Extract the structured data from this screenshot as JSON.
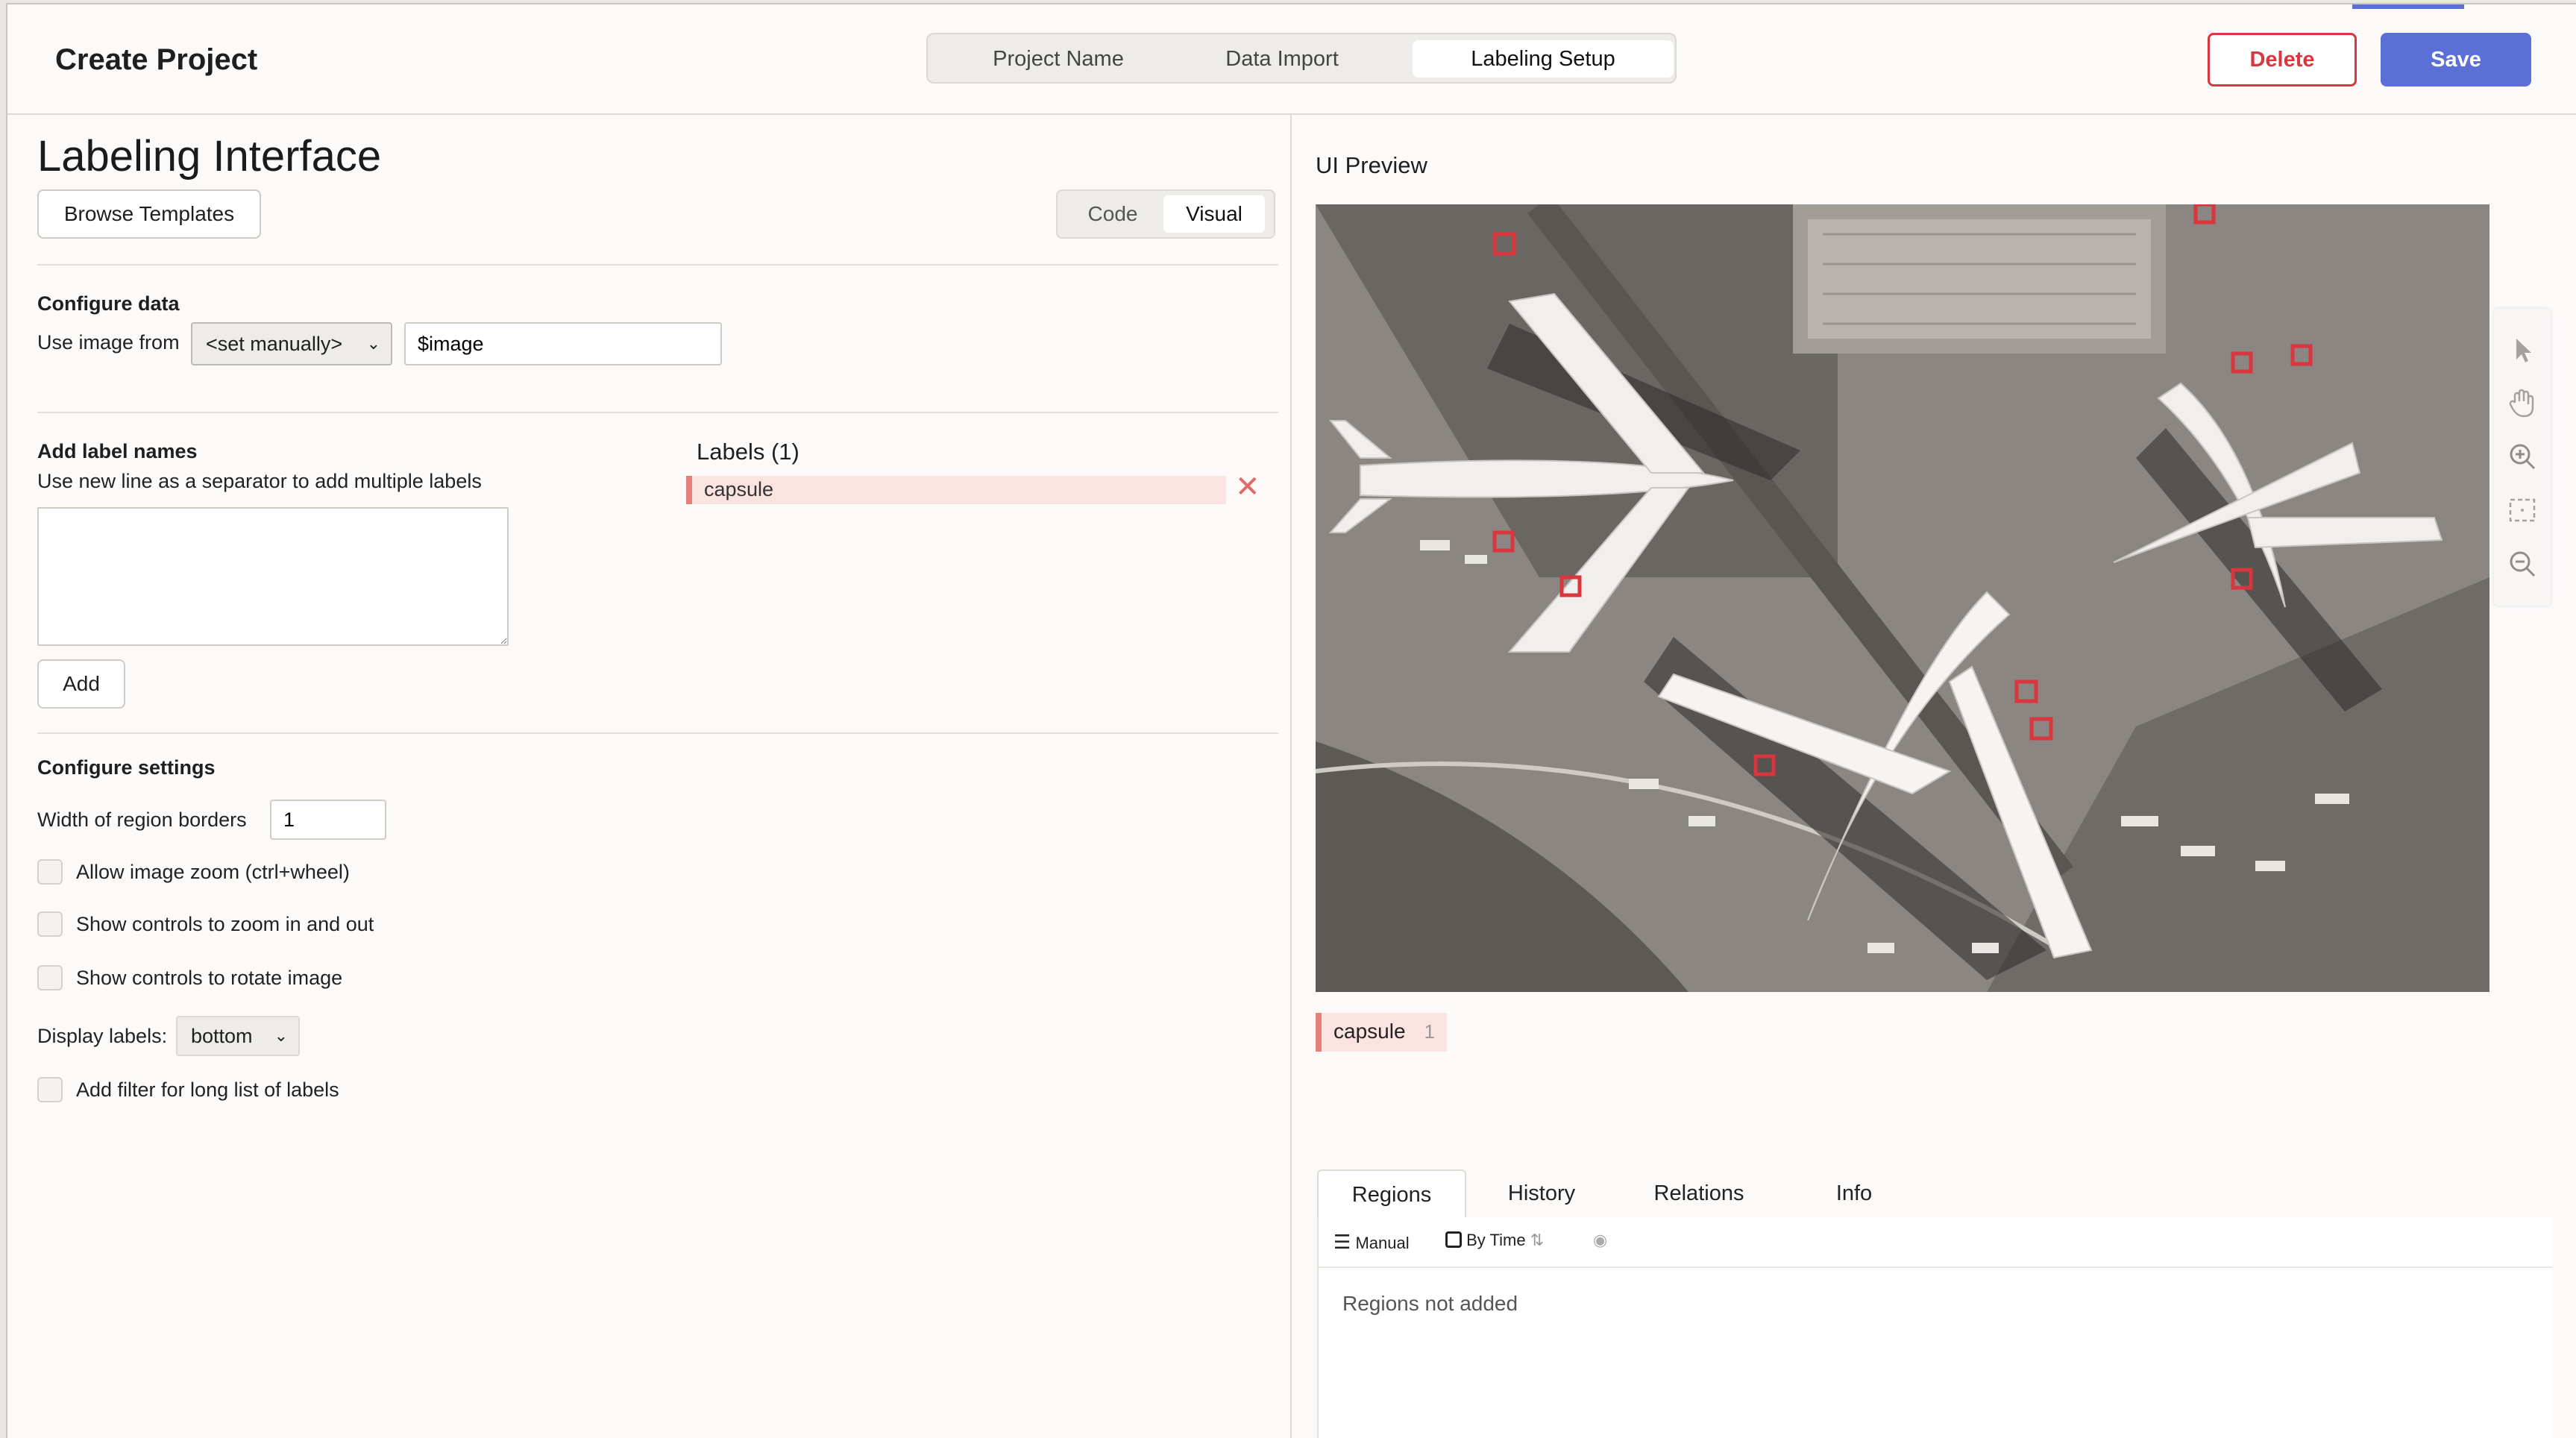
{
  "header": {
    "title": "Create Project",
    "steps": [
      "Project Name",
      "Data Import",
      "Labeling Setup"
    ],
    "active_step": "Labeling Setup",
    "delete_label": "Delete",
    "save_label": "Save",
    "colors": {
      "accent": "#5b6fd6",
      "danger": "#d9363e"
    }
  },
  "left": {
    "heading": "Labeling Interface",
    "browse_templates_label": "Browse Templates",
    "view_toggle": {
      "code": "Code",
      "visual": "Visual",
      "active": "Visual"
    },
    "configure_data": {
      "title": "Configure data",
      "use_image_from": "Use image from",
      "source_select": "<set manually>",
      "value_input": "$image"
    },
    "add_labels": {
      "title": "Add label names",
      "hint": "Use new line as a separator to add multiple labels",
      "textarea_value": "",
      "add_label": "Add"
    },
    "labels_list": {
      "title": "Labels (1)",
      "items": [
        {
          "name": "capsule",
          "color": "#e57f7c"
        }
      ]
    },
    "settings": {
      "title": "Configure settings",
      "border_width_label": "Width of region borders",
      "border_width_value": "1",
      "allow_zoom": "Allow image zoom (ctrl+wheel)",
      "zoom_controls": "Show controls to zoom in and out",
      "rotate_controls": "Show controls to rotate image",
      "display_labels_label": "Display labels:",
      "display_labels_value": "bottom",
      "filter_labels": "Add filter for long list of labels"
    }
  },
  "preview": {
    "title": "UI Preview",
    "image_icon": "aerial-airport-image",
    "label_tag": {
      "name": "capsule",
      "hotkey": "1"
    },
    "tabs": [
      "Regions",
      "History",
      "Relations",
      "Info"
    ],
    "active_tab": "Regions",
    "toolbar": {
      "manual": "Manual",
      "by_time": "By Time"
    },
    "empty_message": "Regions not added"
  }
}
